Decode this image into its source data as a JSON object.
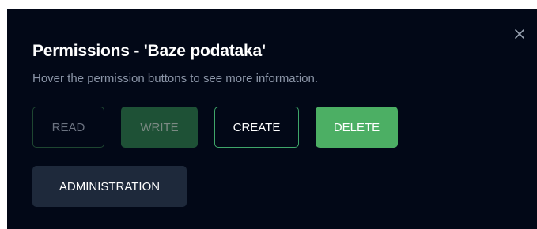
{
  "dialog": {
    "title": "Permissions - 'Baze podataka'",
    "subtitle": "Hover the permission buttons to see more information.",
    "close_icon": "close-icon"
  },
  "permissions": {
    "read": {
      "label": "READ",
      "state": "inactive"
    },
    "write": {
      "label": "WRITE",
      "state": "inactive"
    },
    "create": {
      "label": "CREATE",
      "state": "outlined"
    },
    "delete": {
      "label": "DELETE",
      "state": "active"
    },
    "administration": {
      "label": "ADMINISTRATION",
      "state": "neutral"
    }
  },
  "colors": {
    "background": "#020817",
    "accent_green": "#4caf64",
    "muted_text": "#8b95a7",
    "neutral_button": "#1e293b"
  }
}
